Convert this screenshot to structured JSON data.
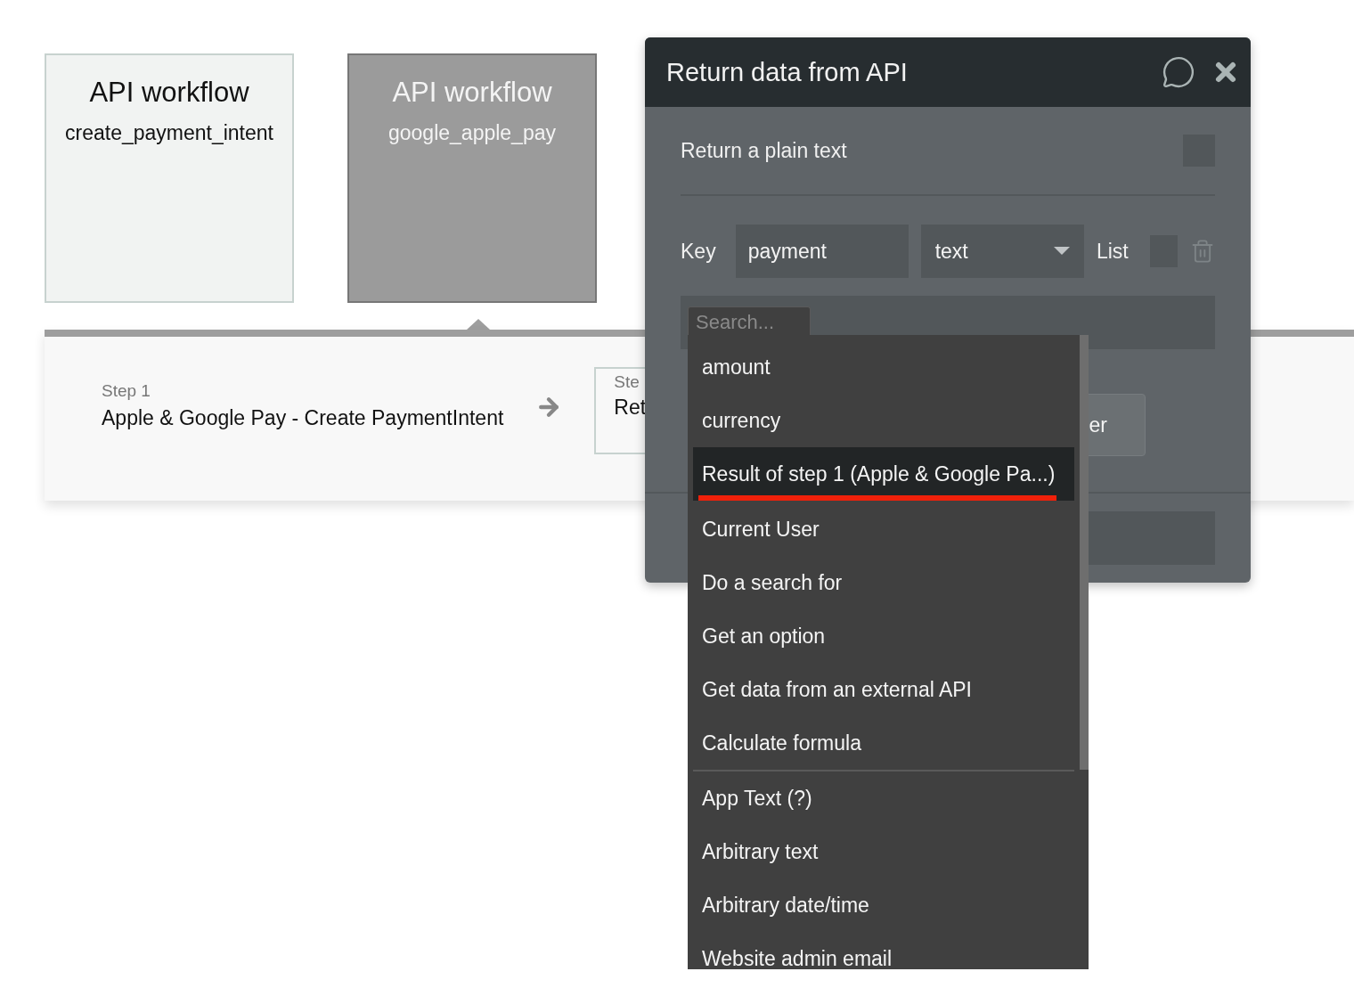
{
  "workflows": [
    {
      "title": "API workflow",
      "name": "create_payment_intent",
      "selected": false
    },
    {
      "title": "API workflow",
      "name": "google_apple_pay",
      "selected": true
    }
  ],
  "steps": [
    {
      "label": "Step 1",
      "title": "Apple & Google Pay - Create PaymentIntent"
    },
    {
      "label": "Ste",
      "title": "Ret"
    }
  ],
  "dialog": {
    "title": "Return data from API",
    "plain_text": {
      "label": "Return a plain text",
      "checked": false
    },
    "key_row": {
      "label": "Key",
      "key": "payment",
      "type": "text",
      "list_label": "List",
      "list_checked": false
    },
    "search": {
      "placeholder": "Search..."
    },
    "button_fragment": "er"
  },
  "dropdown": {
    "sections": [
      [
        {
          "label": "amount",
          "selected": false
        },
        {
          "label": "currency",
          "selected": false
        },
        {
          "label": "Result of step 1 (Apple & Google Pa...)",
          "selected": true
        },
        {
          "label": "Current User",
          "selected": false
        },
        {
          "label": "Do a search for",
          "selected": false
        },
        {
          "label": "Get an option",
          "selected": false
        },
        {
          "label": "Get data from an external API",
          "selected": false
        },
        {
          "label": "Calculate formula",
          "selected": false
        }
      ],
      [
        {
          "label": "App Text (?)",
          "selected": false
        },
        {
          "label": "Arbitrary text",
          "selected": false
        },
        {
          "label": "Arbitrary date/time",
          "selected": false
        },
        {
          "label": "Website admin email",
          "selected": false
        }
      ]
    ]
  }
}
